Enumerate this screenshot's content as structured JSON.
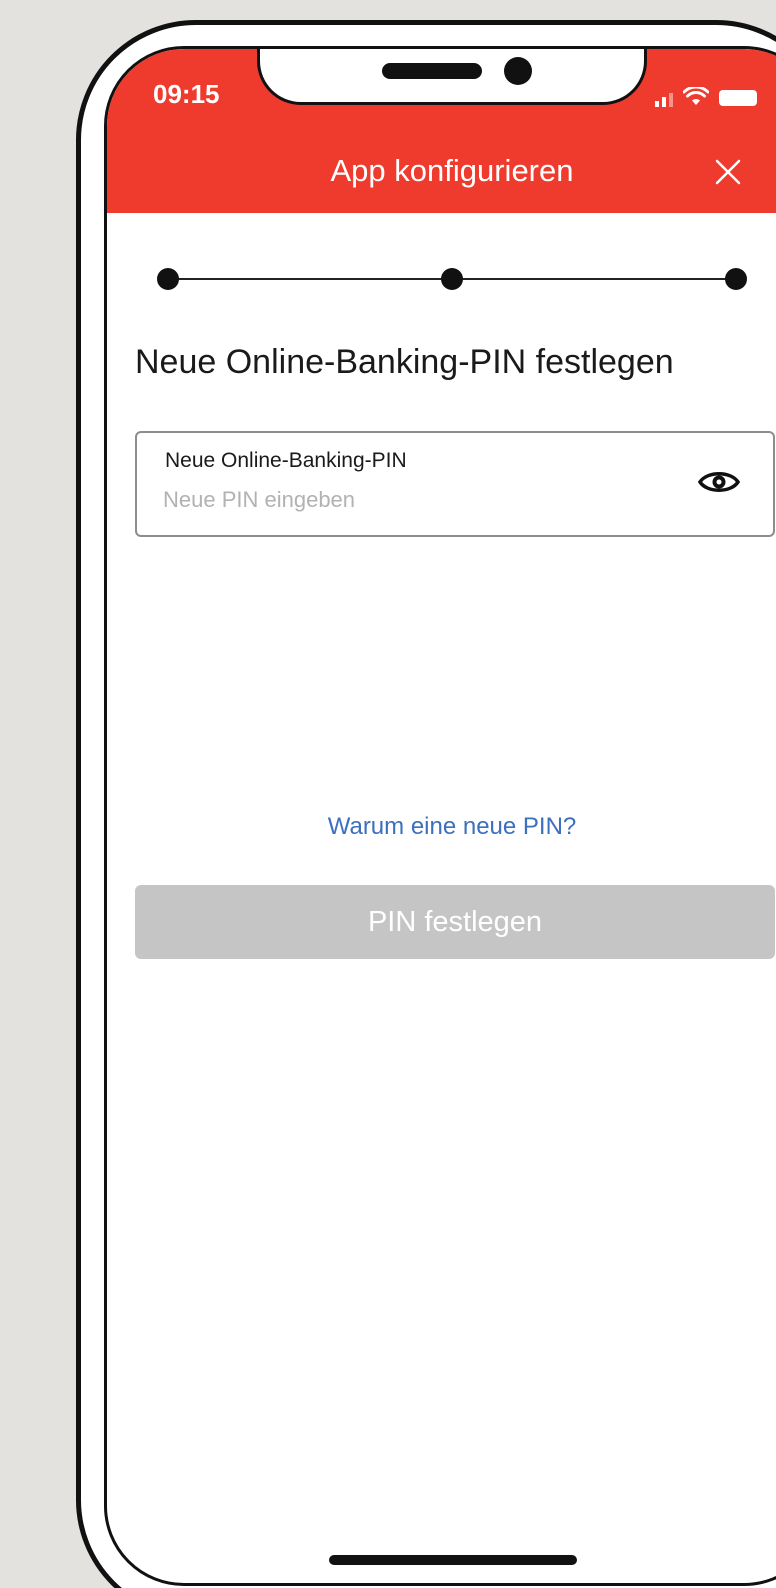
{
  "status_bar": {
    "time": "09:15",
    "icons": [
      "signal-icon",
      "wifi-icon",
      "battery-icon"
    ]
  },
  "header": {
    "title": "App konfigurieren",
    "close_icon": "close-icon",
    "background_color": "#ee3b2e"
  },
  "stepper": {
    "steps": 3
  },
  "main": {
    "heading": "Neue Online-Banking-PIN festlegen",
    "pin_field": {
      "label": "Neue Online-Banking-PIN",
      "placeholder": "Neue PIN eingeben",
      "value": "",
      "toggle_icon": "eye-icon"
    },
    "why_link": "Warum eine neue PIN?",
    "submit_button": "PIN festlegen"
  },
  "colors": {
    "accent": "#ee3b2e",
    "link": "#3c6fc0",
    "button_disabled": "#c4c5c4"
  }
}
